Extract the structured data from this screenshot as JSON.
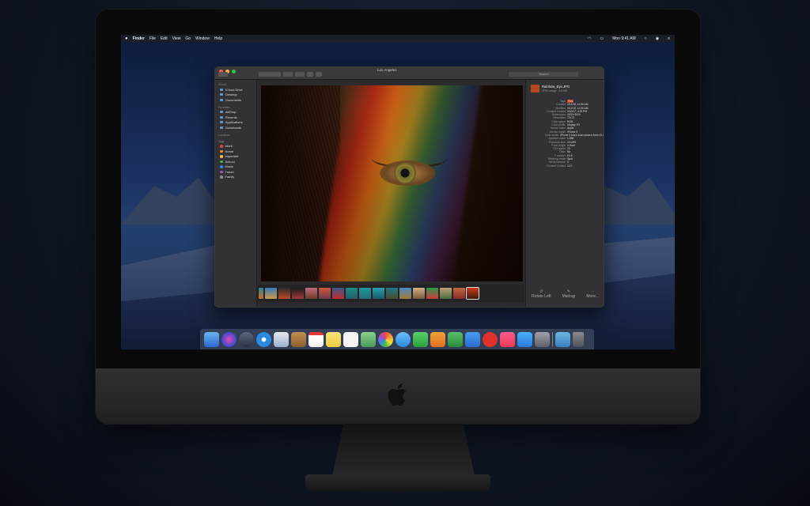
{
  "menubar": {
    "apple": "",
    "items": [
      "Finder",
      "File",
      "Edit",
      "View",
      "Go",
      "Window",
      "Help"
    ],
    "clock": "Mon 9:41 AM"
  },
  "window": {
    "title": "Los Angeles",
    "search_placeholder": "Search"
  },
  "sidebar": {
    "sections": [
      {
        "title": "iCloud",
        "items": [
          "iCloud Drive",
          "Desktop",
          "Documents"
        ]
      },
      {
        "title": "Favorites",
        "items": [
          "AirDrop",
          "Recents",
          "Applications",
          "Downloads"
        ]
      },
      {
        "title": "Locations",
        "items": []
      },
      {
        "title": "Tags",
        "items": [
          "Work",
          "Home",
          "Important",
          "School",
          "Music",
          "Travel",
          "Family"
        ]
      }
    ],
    "tag_colors": [
      "#e0443c",
      "#f08a24",
      "#f2c232",
      "#46b04a",
      "#3a84e6",
      "#9b59c6",
      "#8e8e93"
    ]
  },
  "info": {
    "filename": "Rainbow_Eye.JPG",
    "filetype": "JPEG image - 3.6 MB",
    "rows": [
      [
        "Tags",
        "Red"
      ],
      [
        "Created",
        "2/12/18, 11:56 AM"
      ],
      [
        "Modified",
        "2/12/18, 11:56 AM"
      ],
      [
        "Content created",
        "4/20/17, 4:15 PM"
      ],
      [
        "Dimensions",
        "4032×3024"
      ],
      [
        "Resolution",
        "72×72"
      ],
      [
        "Color space",
        "RGB"
      ],
      [
        "Color profile",
        "Display P3"
      ],
      [
        "Device make",
        "Apple"
      ],
      [
        "Device model",
        "iPhone X"
      ],
      [
        "Lens model",
        "iPhone X back dual camera 4mm f/1.8"
      ],
      [
        "Aperture value",
        "1.696"
      ],
      [
        "Exposure time",
        "1/4,095"
      ],
      [
        "Focal length",
        "4.0mm"
      ],
      [
        "ISO speed",
        "20"
      ],
      [
        "Flash",
        "No"
      ],
      [
        "F number",
        "f/1.8"
      ],
      [
        "Metering mode",
        "Spot"
      ],
      [
        "White balance",
        "0"
      ],
      [
        "Content Creator",
        "11.0"
      ]
    ],
    "actions": [
      {
        "icon": "↺",
        "label": "Rotate Left"
      },
      {
        "icon": "✎",
        "label": "Markup"
      },
      {
        "icon": "⋯",
        "label": "More..."
      }
    ]
  },
  "colors": {
    "accent": "#3a84e6",
    "window_bg": "#2b2b2d"
  }
}
